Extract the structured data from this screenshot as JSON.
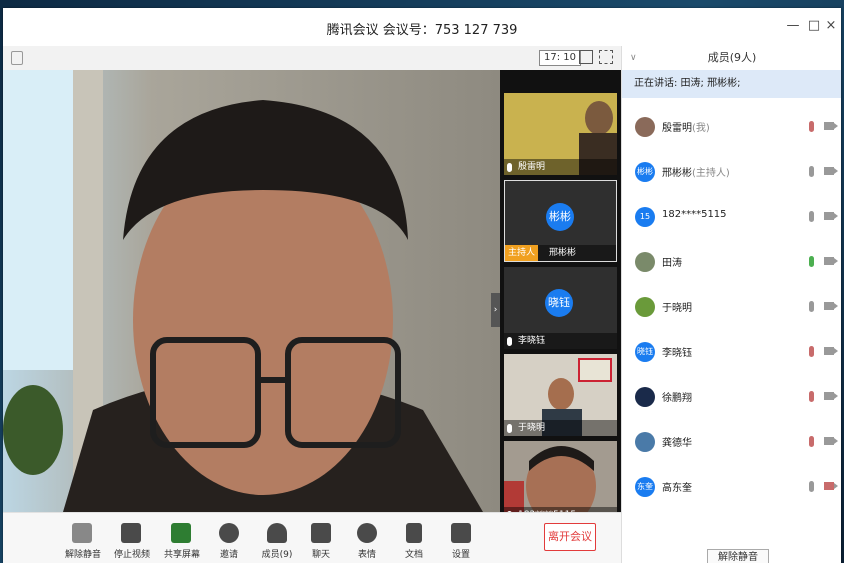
{
  "window": {
    "title": "腾讯会议  会议号：753 127 739",
    "controls": [
      "—",
      "□",
      "×"
    ]
  },
  "top_toolbar": {
    "clock": "17: 10"
  },
  "participants_strip": [
    {
      "name": "殷雷明",
      "type": "video"
    },
    {
      "name": "邢彬彬",
      "type": "avatar",
      "avatar_text": "彬彬",
      "badge": "主持人"
    },
    {
      "name": "李晓钰",
      "type": "avatar",
      "avatar_text": "晓钰"
    },
    {
      "name": "于晓明",
      "type": "video"
    },
    {
      "name": "182****5115",
      "type": "video"
    }
  ],
  "bottom_toolbar": {
    "buttons": [
      "解除静音",
      "停止视频",
      "共享屏幕",
      "邀请",
      "成员(9)",
      "聊天",
      "表情",
      "文档",
      "设置"
    ],
    "leave": "离开会议"
  },
  "members_panel": {
    "header": "成员(9人)",
    "speaking": "正在讲话: 田涛; 邢彬彬;",
    "members": [
      {
        "name": "殷雷明",
        "role": "(我)",
        "avatar_text": "",
        "mic": "muted"
      },
      {
        "name": "邢彬彬",
        "role": "(主持人)",
        "avatar_text": "彬彬",
        "mic": "normal"
      },
      {
        "name": "182****5115",
        "role": "",
        "avatar_text": "15",
        "mic": "normal"
      },
      {
        "name": "田涛",
        "role": "",
        "avatar_text": "",
        "mic": "on"
      },
      {
        "name": "于晓明",
        "role": "",
        "avatar_text": "",
        "mic": "normal"
      },
      {
        "name": "李晓钰",
        "role": "",
        "avatar_text": "晓钰",
        "mic": "muted"
      },
      {
        "name": "徐鹏翔",
        "role": "",
        "avatar_text": "",
        "mic": "muted"
      },
      {
        "name": "龚德华",
        "role": "",
        "avatar_text": "",
        "mic": "muted"
      },
      {
        "name": "高东奎",
        "role": "",
        "avatar_text": "东奎",
        "mic": "normal"
      }
    ],
    "unmute_all": "解除静音"
  }
}
